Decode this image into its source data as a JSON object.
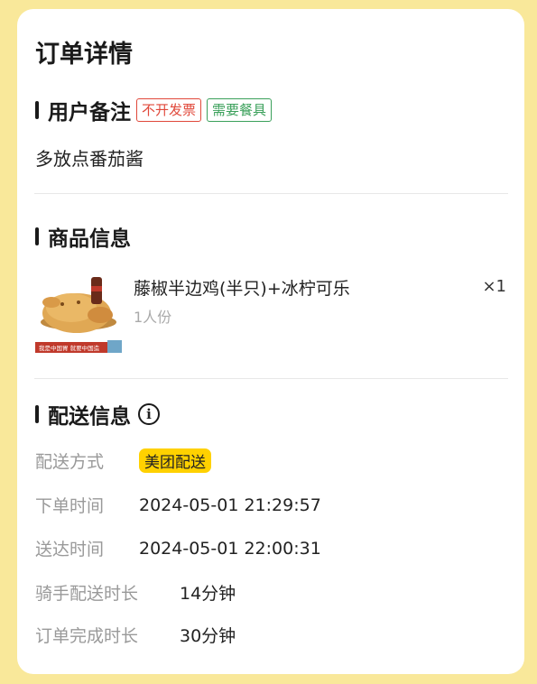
{
  "page": {
    "title": "订单详情"
  },
  "remark_section": {
    "title": "用户备注",
    "tags": [
      {
        "label": "不开发票",
        "color": "#e0483a"
      },
      {
        "label": "需要餐具",
        "color": "#3aa05a"
      }
    ],
    "text": "多放点番茄酱"
  },
  "product_section": {
    "title": "商品信息",
    "items": [
      {
        "name": "藤椒半边鸡(半只)+冰柠可乐",
        "spec": "1人份",
        "qty": "×1",
        "image_icon": "roast-chicken-image",
        "image_banner_text": "我是中国胃 就要中国造"
      }
    ]
  },
  "delivery_section": {
    "title": "配送信息",
    "info_icon": "info-icon",
    "rows": [
      {
        "label": "配送方式",
        "value": "美团配送"
      },
      {
        "label": "下单时间",
        "value": "2024-05-01 21:29:57"
      },
      {
        "label": "送达时间",
        "value": "2024-05-01 22:00:31"
      },
      {
        "label": "骑手配送时长",
        "value": "14分钟"
      },
      {
        "label": "订单完成时长",
        "value": "30分钟"
      }
    ]
  },
  "colors": {
    "background": "#f9e89a",
    "meituan_yellow": "#ffd100"
  }
}
